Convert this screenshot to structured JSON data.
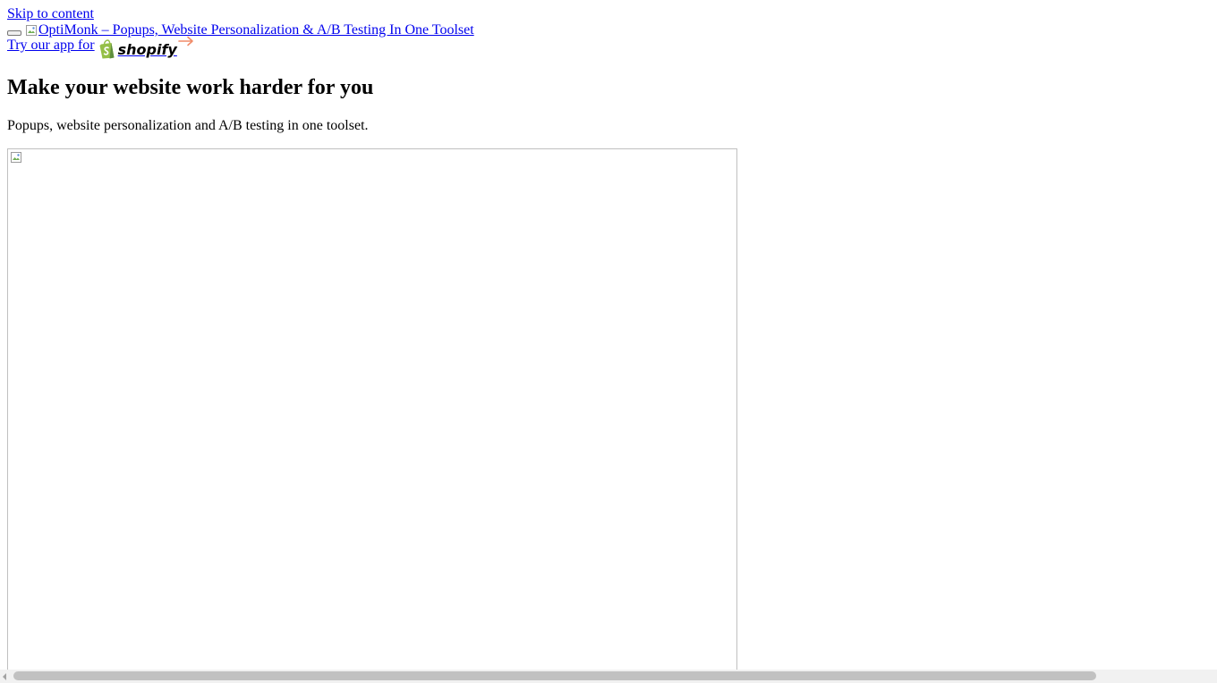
{
  "skip_link": {
    "label": "Skip to content"
  },
  "header": {
    "menu_toggle": {
      "label": ""
    },
    "logo": {
      "alt": "OptiMonk – Popups, Website Personalization & A/B Testing In One Toolset"
    }
  },
  "shopify_cta": {
    "text": "Try our app for",
    "brand_name": "shopify",
    "brand_color": "#95bf47",
    "arrow_color": "#f08c6a",
    "arrow_icon": "arrow-right-icon"
  },
  "hero": {
    "headline": "Make your website work harder for you",
    "subtitle": "Popups, website personalization and A/B testing in one toolset.",
    "image_icon": "broken-image-icon"
  },
  "colors": {
    "link": "#0000ee",
    "text": "#000000",
    "background": "#ffffff",
    "scrollbar_thumb": "#c1c1c1",
    "scrollbar_track": "#f1f1f1"
  }
}
